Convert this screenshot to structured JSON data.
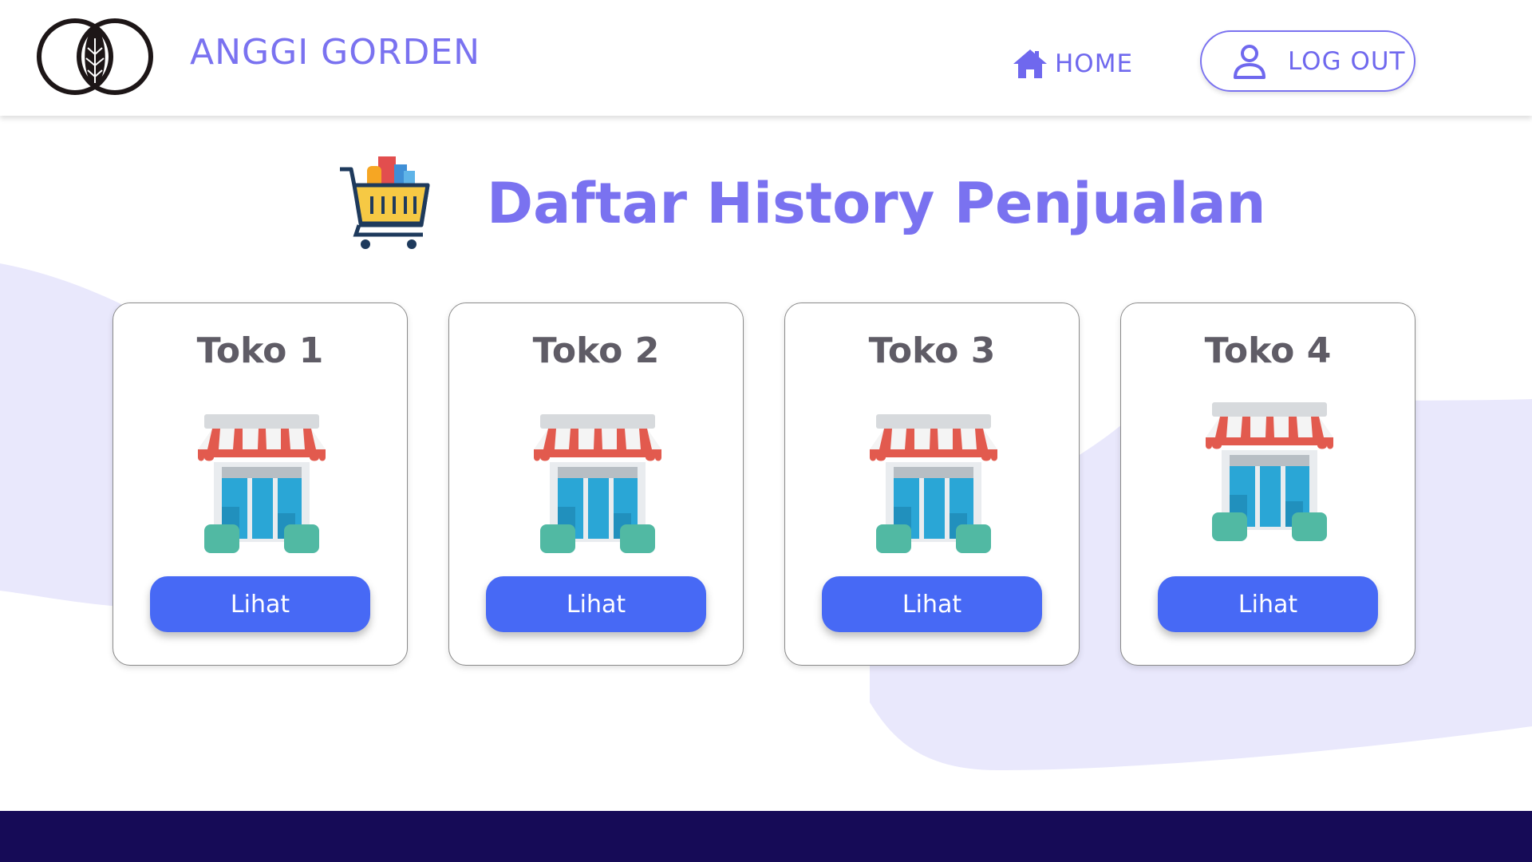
{
  "brand": {
    "name": "ANGGI GORDEN",
    "logo_icon": "leaf-rings-logo"
  },
  "nav": {
    "home_label": "HOME",
    "home_icon": "house-icon",
    "logout_label": "LOG OUT",
    "logout_icon": "user-icon"
  },
  "page": {
    "title": "Daftar History Penjualan",
    "title_icon": "shopping-cart-icon"
  },
  "stores": [
    {
      "name": "Toko 1",
      "button_label": "Lihat",
      "icon": "storefront-icon"
    },
    {
      "name": "Toko 2",
      "button_label": "Lihat",
      "icon": "storefront-icon"
    },
    {
      "name": "Toko 3",
      "button_label": "Lihat",
      "icon": "storefront-icon"
    },
    {
      "name": "Toko 4",
      "button_label": "Lihat",
      "icon": "storefront-icon"
    }
  ],
  "colors": {
    "accent": "#7a72f0",
    "button": "#4769f5",
    "footer": "#160b57",
    "blob": "#e9e8fc"
  }
}
